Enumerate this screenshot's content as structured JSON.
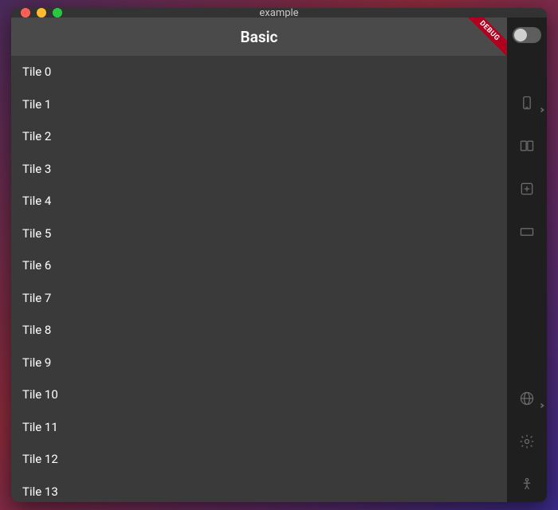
{
  "window": {
    "title": "example"
  },
  "appbar": {
    "title": "Basic",
    "debug_label": "DEBUG"
  },
  "list": {
    "items": [
      {
        "label": "Tile 0"
      },
      {
        "label": "Tile 1"
      },
      {
        "label": "Tile 2"
      },
      {
        "label": "Tile 3"
      },
      {
        "label": "Tile 4"
      },
      {
        "label": "Tile 5"
      },
      {
        "label": "Tile 6"
      },
      {
        "label": "Tile 7"
      },
      {
        "label": "Tile 8"
      },
      {
        "label": "Tile 9"
      },
      {
        "label": "Tile 10"
      },
      {
        "label": "Tile 11"
      },
      {
        "label": "Tile 12"
      },
      {
        "label": "Tile 13"
      }
    ]
  },
  "rail": {
    "toggle": {
      "on": false
    },
    "items": [
      {
        "icon": "device-icon",
        "chevron": true
      },
      {
        "icon": "columns-icon",
        "chevron": false
      },
      {
        "icon": "grid-add-icon",
        "chevron": false
      },
      {
        "icon": "keyboard-icon",
        "chevron": false
      }
    ],
    "bottom_items": [
      {
        "icon": "globe-icon",
        "chevron": true
      },
      {
        "icon": "gear-icon",
        "chevron": false
      },
      {
        "icon": "accessibility-icon",
        "chevron": false
      }
    ]
  }
}
